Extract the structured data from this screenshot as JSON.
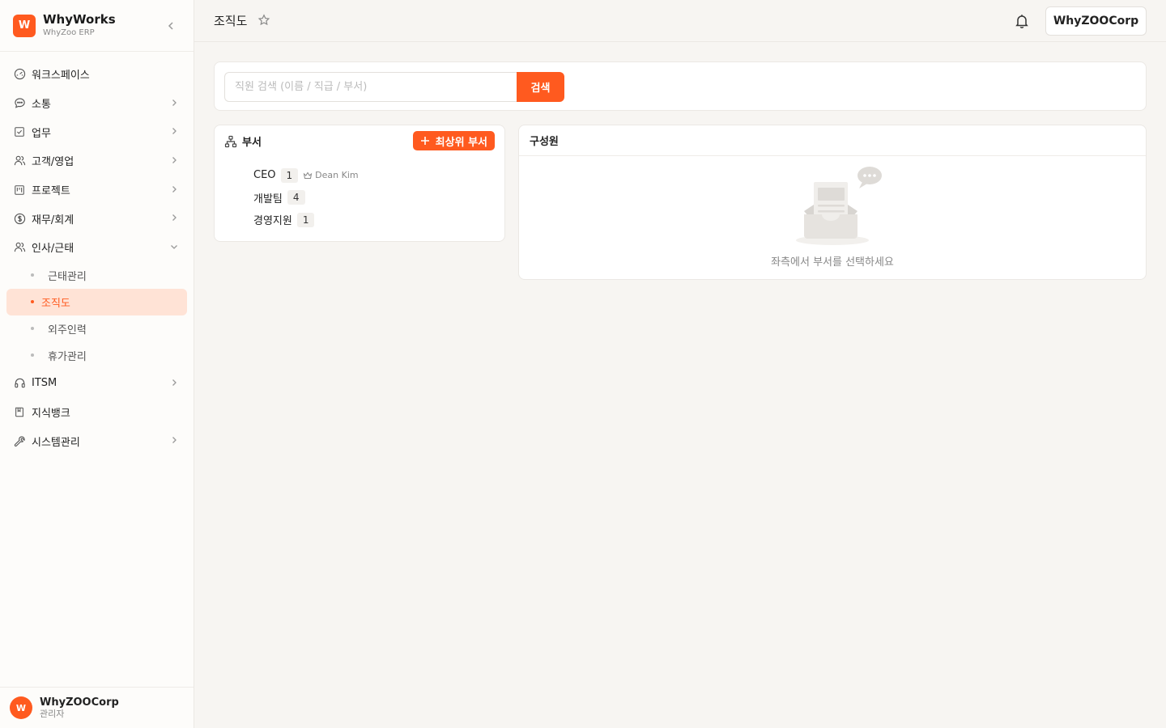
{
  "brand": {
    "logo_letter": "W",
    "name": "WhyWorks",
    "subtitle": "WhyZoo ERP"
  },
  "nav": {
    "items": [
      {
        "label": "워크스페이스",
        "icon": "dashboard-icon",
        "has_children": false
      },
      {
        "label": "소통",
        "icon": "chat-icon",
        "has_children": true
      },
      {
        "label": "업무",
        "icon": "checkbox-icon",
        "has_children": true
      },
      {
        "label": "고객/영업",
        "icon": "users-icon",
        "has_children": true
      },
      {
        "label": "프로젝트",
        "icon": "kanban-icon",
        "has_children": true
      },
      {
        "label": "재무/회계",
        "icon": "dollar-icon",
        "has_children": true
      },
      {
        "label": "인사/근태",
        "icon": "people-icon",
        "has_children": true,
        "expanded": true
      }
    ],
    "hr_sub": [
      {
        "label": "근태관리",
        "active": false
      },
      {
        "label": "조직도",
        "active": true
      },
      {
        "label": "외주인력",
        "active": false
      },
      {
        "label": "휴가관리",
        "active": false
      }
    ],
    "items_after": [
      {
        "label": "ITSM",
        "icon": "headset-icon",
        "has_children": true
      },
      {
        "label": "지식뱅크",
        "icon": "book-icon",
        "has_children": false
      },
      {
        "label": "시스템관리",
        "icon": "wrench-icon",
        "has_children": true
      }
    ]
  },
  "user": {
    "avatar_letter": "W",
    "name": "WhyZOOCorp",
    "role": "관리자"
  },
  "header": {
    "title": "조직도",
    "corp_button": "WhyZOOCorp"
  },
  "search": {
    "placeholder": "직원 검색 (이름 / 직급 / 부서)",
    "value": "",
    "button_label": "검색"
  },
  "departments": {
    "title": "부서",
    "add_button": "최상위 부서",
    "rows": [
      {
        "name": "CEO",
        "count": "1",
        "leader": "Dean Kim"
      },
      {
        "name": "개발팀",
        "count": "4"
      },
      {
        "name": "경영지원",
        "count": "1"
      }
    ]
  },
  "members": {
    "title": "구성원",
    "empty_message": "좌측에서 부서를 선택하세요"
  },
  "colors": {
    "accent": "#ff5a1f",
    "accent_soft": "#ffe3d6",
    "background": "#f7f5f2"
  }
}
